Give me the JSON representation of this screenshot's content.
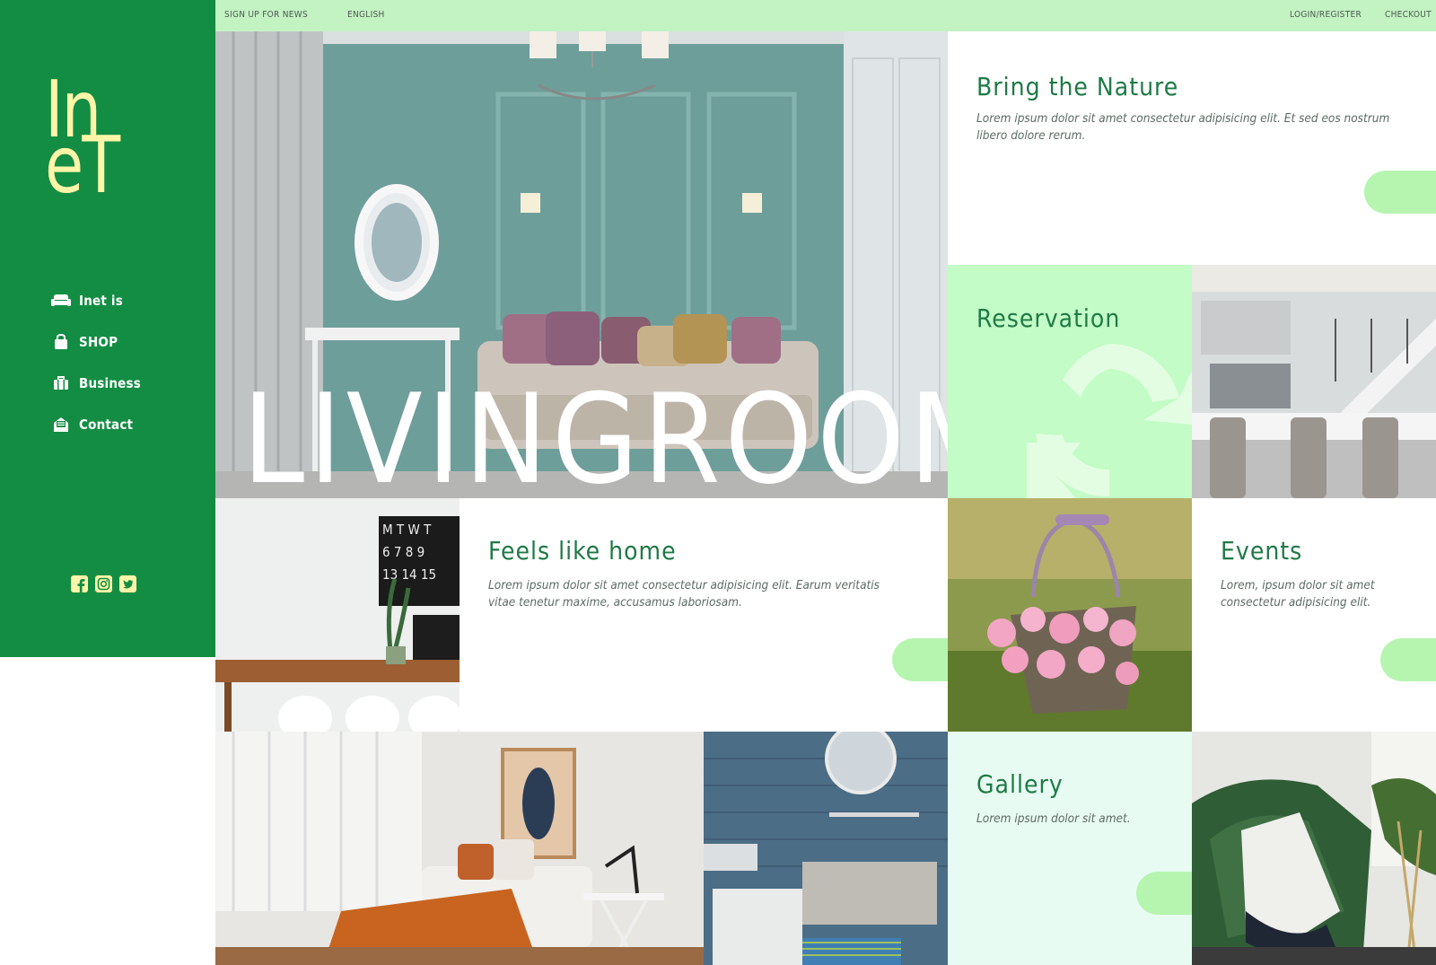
{
  "brand": {
    "logo_line1": "In",
    "logo_line2": "eT"
  },
  "nav": [
    {
      "label": "Inet is",
      "icon": "sofa-icon"
    },
    {
      "label": "SHOP",
      "icon": "shopping-bag-icon"
    },
    {
      "label": "Business",
      "icon": "briefcase-icon"
    },
    {
      "label": "Contact",
      "icon": "envelope-icon"
    }
  ],
  "social": [
    "facebook-icon",
    "instagram-icon",
    "twitter-icon"
  ],
  "topbar": {
    "signup": "SIGN UP FOR NEWS",
    "language": "ENGLISH",
    "login": "LOGIN/REGISTER",
    "checkout": "CHECKOUT"
  },
  "hero": {
    "title": "LIVINGROOM"
  },
  "cards": {
    "nature": {
      "title": "Bring the Nature",
      "text": "Lorem ipsum dolor sit amet consectetur adipisicing elit. Et sed eos nostrum libero dolore rerum."
    },
    "reservation": {
      "title": "Reservation",
      "icon": "refresh-icon"
    },
    "home": {
      "title": "Feels like home",
      "text": "Lorem ipsum dolor sit amet consectetur adipisicing elit. Earum veritatis vitae tenetur maxime, accusamus laboriosam."
    },
    "events": {
      "title": "Events",
      "text": "Lorem, ipsum dolor sit amet consectetur adipisicing elit."
    },
    "gallery": {
      "title": "Gallery",
      "text": "Lorem ipsum dolor sit amet."
    }
  },
  "colors": {
    "sidebar": "#138d43",
    "topbar": "#c3f2c3",
    "logo": "#fdf6a8",
    "mint": "#c3fcc6",
    "pill": "#b6f5b0",
    "heading": "#1f7a46"
  }
}
